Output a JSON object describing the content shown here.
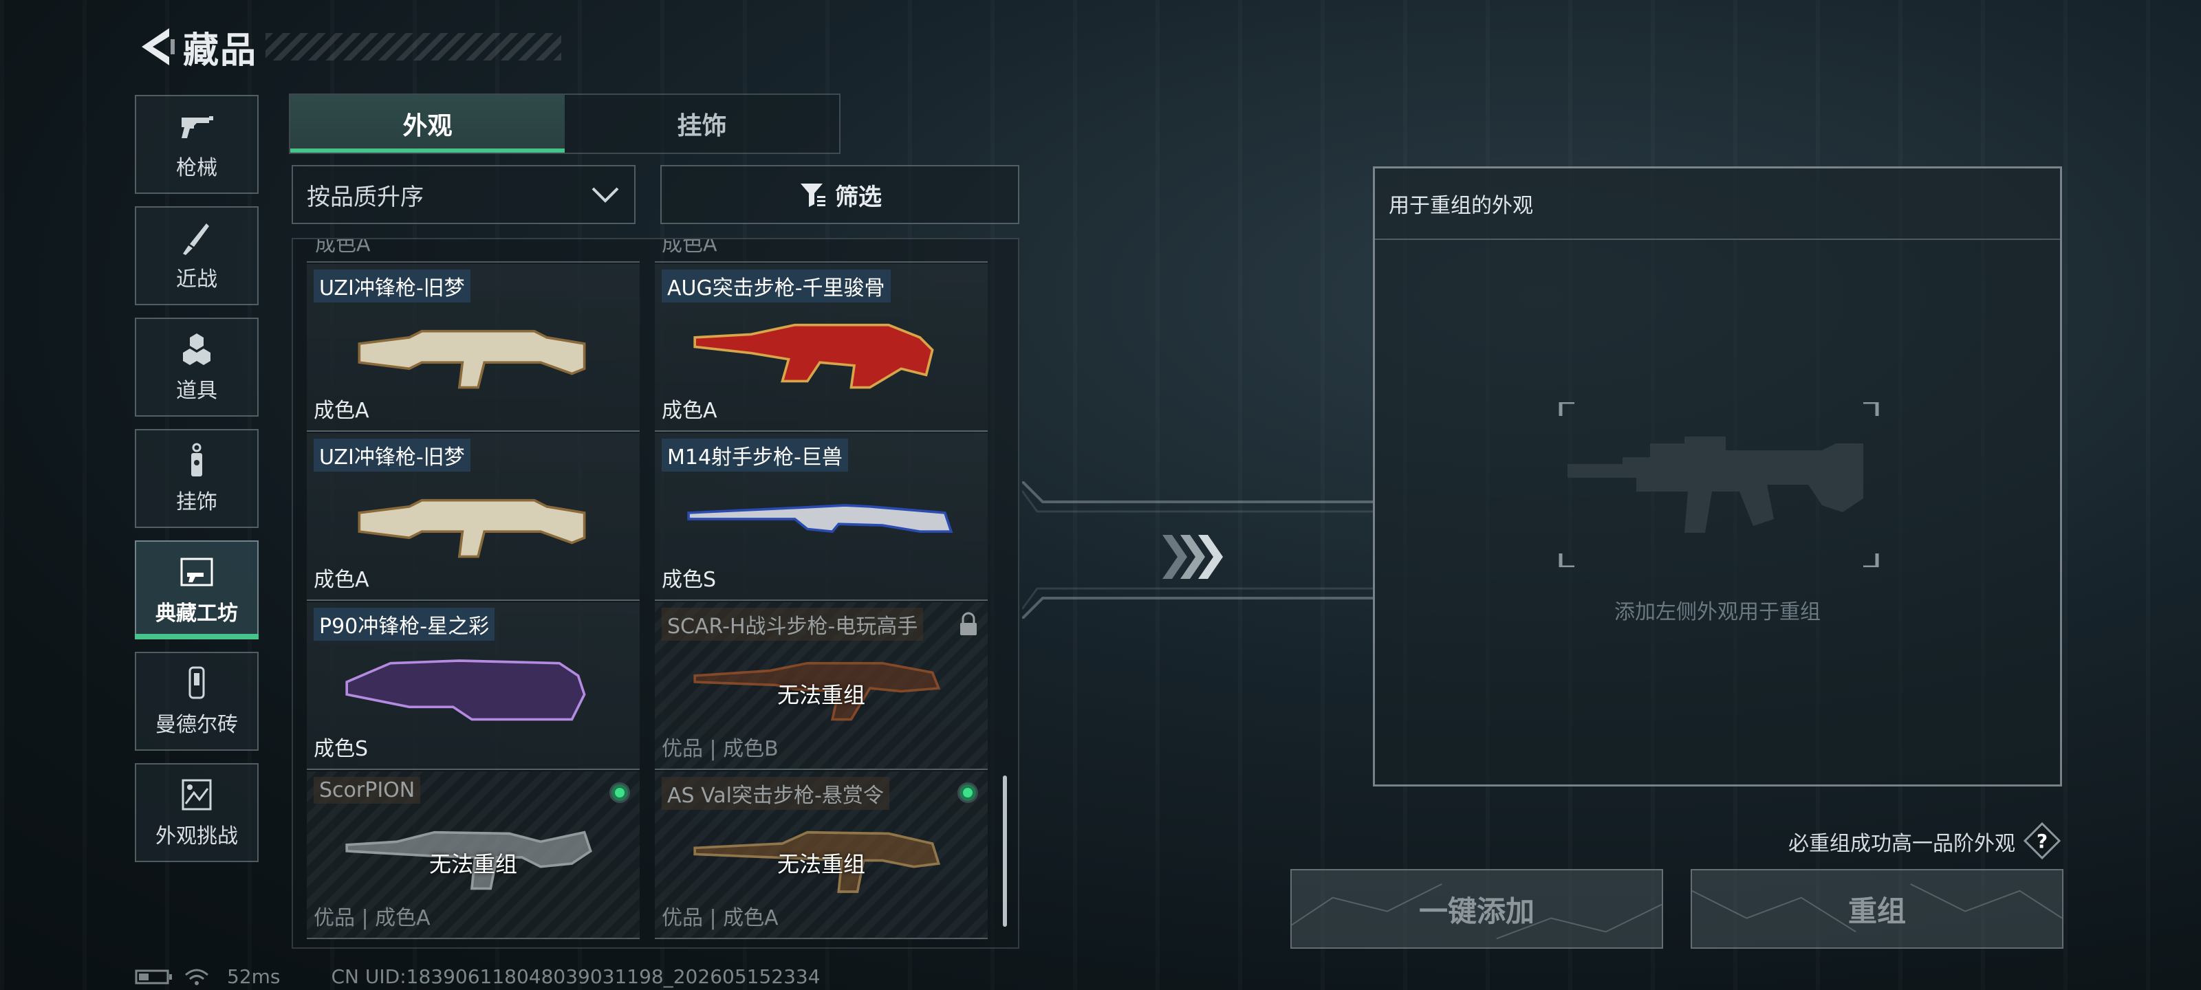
{
  "header": {
    "title": "藏品"
  },
  "sidebar": {
    "items": [
      {
        "label": "枪械",
        "icon": "pistol-icon",
        "active": false
      },
      {
        "label": "近战",
        "icon": "knife-icon",
        "active": false
      },
      {
        "label": "道具",
        "icon": "grenade-icon",
        "active": false
      },
      {
        "label": "挂饰",
        "icon": "charm-icon",
        "active": false
      },
      {
        "label": "典藏工坊",
        "icon": "workshop-icon",
        "active": true
      },
      {
        "label": "曼德尔砖",
        "icon": "brick-icon",
        "active": false
      },
      {
        "label": "外观挑战",
        "icon": "challenge-icon",
        "active": false
      }
    ]
  },
  "tabs": [
    {
      "label": "外观",
      "active": true
    },
    {
      "label": "挂饰",
      "active": false
    }
  ],
  "sort": {
    "value": "按品质升序"
  },
  "filter": {
    "label": "筛选"
  },
  "list": {
    "partial_labels": [
      "成色A",
      "成色A"
    ],
    "cards": [
      {
        "name": "UZI冲锋枪-旧梦",
        "grade": "成色A",
        "available": true,
        "skin": "uzi-bone"
      },
      {
        "name": "AUG突击步枪-千里骏骨",
        "grade": "成色A",
        "available": true,
        "skin": "aug-red"
      },
      {
        "name": "UZI冲锋枪-旧梦",
        "grade": "成色A",
        "available": true,
        "skin": "uzi-bone"
      },
      {
        "name": "M14射手步枪-巨兽",
        "grade": "成色S",
        "available": true,
        "skin": "m14-blue"
      },
      {
        "name": "P90冲锋枪-星之彩",
        "grade": "成色S",
        "available": true,
        "skin": "p90-purple"
      },
      {
        "name": "SCAR-H战斗步枪-电玩高手",
        "grade": "优品 | 成色B",
        "available": false,
        "badge": "lock-icon",
        "cannot": "无法重组",
        "skin": "scar-brown"
      },
      {
        "name": "ScorPION",
        "grade": "优品 | 成色A",
        "available": false,
        "badge": "green-dot-icon",
        "cannot": "无法重组",
        "skin": "scorpion-gray"
      },
      {
        "name": "AS Val突击步枪-悬赏令",
        "grade": "优品 | 成色A",
        "available": false,
        "badge": "green-dot-icon",
        "cannot": "无法重组",
        "skin": "asval-brown"
      }
    ]
  },
  "reforge_panel": {
    "title": "用于重组的外观",
    "hint": "添加左侧外观用于重组"
  },
  "rule_text": "必重组成功高一品阶外观",
  "buttons": {
    "add_all": "一键添加",
    "reforge": "重组"
  },
  "status": {
    "ping": "52ms",
    "uid": "CN UID:1839061180480390311­98_202605152334"
  },
  "colors": {
    "accent": "#47c38c",
    "tag_bg": "#263e54"
  }
}
